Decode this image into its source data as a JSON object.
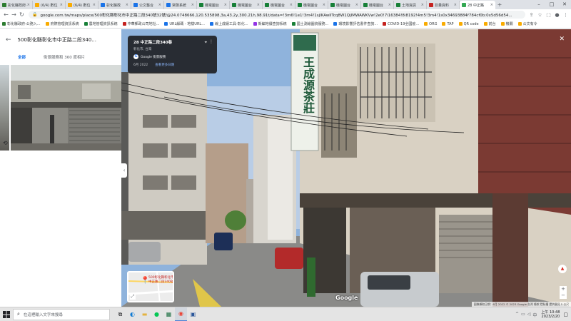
{
  "browser": {
    "tabs": [
      {
        "title": "彰化縣政府-公務入",
        "fav_color": "#2e7d32",
        "active": false
      },
      {
        "title": "(6/4) 數位",
        "fav_color": "#f9ab00",
        "active": false
      },
      {
        "title": "(6/4) 數位",
        "fav_color": "#f9ab00",
        "active": false
      },
      {
        "title": "彰化縣政",
        "fav_color": "#1a73e8",
        "active": false
      },
      {
        "title": "公文整合",
        "fav_color": "#1a73e8",
        "active": false
      },
      {
        "title": "常態系統",
        "fav_color": "#1a73e8",
        "active": false
      },
      {
        "title": "機電圖台",
        "fav_color": "#188038",
        "active": false
      },
      {
        "title": "機電圖台",
        "fav_color": "#188038",
        "active": false
      },
      {
        "title": "機電圖台",
        "fav_color": "#188038",
        "active": false
      },
      {
        "title": "機電圖台",
        "fav_color": "#188038",
        "active": false
      },
      {
        "title": "機電圖台",
        "fav_color": "#188038",
        "active": false
      },
      {
        "title": "機電圖台",
        "fav_color": "#188038",
        "active": false
      },
      {
        "title": "土地資訊",
        "fav_color": "#188038",
        "active": false
      },
      {
        "title": "巨量資料",
        "fav_color": "#c5221f",
        "active": false
      },
      {
        "title": "28 中正路",
        "fav_color": "#34a853",
        "active": true
      }
    ],
    "url": "google.com.tw/maps/place/500彰化縣彰化市中正路二段340號32號/@24.0748666,120.535898,3a,43.2y,300.21h,98.91t/data=!3m6!1e1!3m4!1sjlKAwIlTcq8W1QjIMWAWKVw!2e0!7i16384!8i8192!4m5!3m4!1s0x34693884f784cf0b:0x5d56d54...",
    "bookmarks": [
      {
        "label": "彰化縣政府-公務入...",
        "color": "#2e7d32"
      },
      {
        "label": "府際管理資訊系統",
        "color": "#f9ab00"
      },
      {
        "label": "農地管理資訊系統",
        "color": "#188038"
      },
      {
        "label": "中華郵政公司地址...",
        "color": "#c5221f"
      },
      {
        "label": "URL解碼 - 地樣URL...",
        "color": "#1a73e8"
      },
      {
        "label": "線上成績工具-彰化...",
        "color": "#1a73e8"
      },
      {
        "label": "新編地價查詢系統",
        "color": "#9334e6"
      },
      {
        "label": "國土測繪圖資服務...",
        "color": "#188038"
      },
      {
        "label": "環境影響評估書件查詢...",
        "color": "#1a73e8"
      },
      {
        "label": "COVID-19全國疫...",
        "color": "#c5221f"
      },
      {
        "label": "ORG",
        "color": "#f9ab00"
      },
      {
        "label": "TAP",
        "color": "#f9ab00"
      },
      {
        "label": "QR code",
        "color": "#f9ab00"
      },
      {
        "label": "前台",
        "color": "#f9ab00"
      },
      {
        "label": "機關",
        "color": "#f9ab00"
      },
      {
        "label": "公文有令",
        "color": "#f9ab00"
      }
    ]
  },
  "left_panel": {
    "title": "500彰化縣彰化市中正路二段340...",
    "tabs": [
      {
        "label": "全部",
        "active": true
      },
      {
        "label": "街景服務和 360 度相片",
        "active": false
      }
    ]
  },
  "streetview": {
    "info_title": "28 中正路二段340巷",
    "info_sub": "彰化市, 台灣",
    "source": "Google 街景服務",
    "date": "6月 2022",
    "more_dates": "查看更多日期",
    "sign_text": "王成源茶莊",
    "minimap_label": "500彰化縣彰化市中正路二段340號",
    "google": "Google",
    "attribution": "圖像擷取日期：6月 2022   © 2023 Google   台灣   條款   隱私權   提供意見   5 公尺"
  },
  "taskbar": {
    "search_placeholder": "在這裡輸入文字來搜尋",
    "time": "上午 10:48",
    "date": "2023/2/20"
  }
}
